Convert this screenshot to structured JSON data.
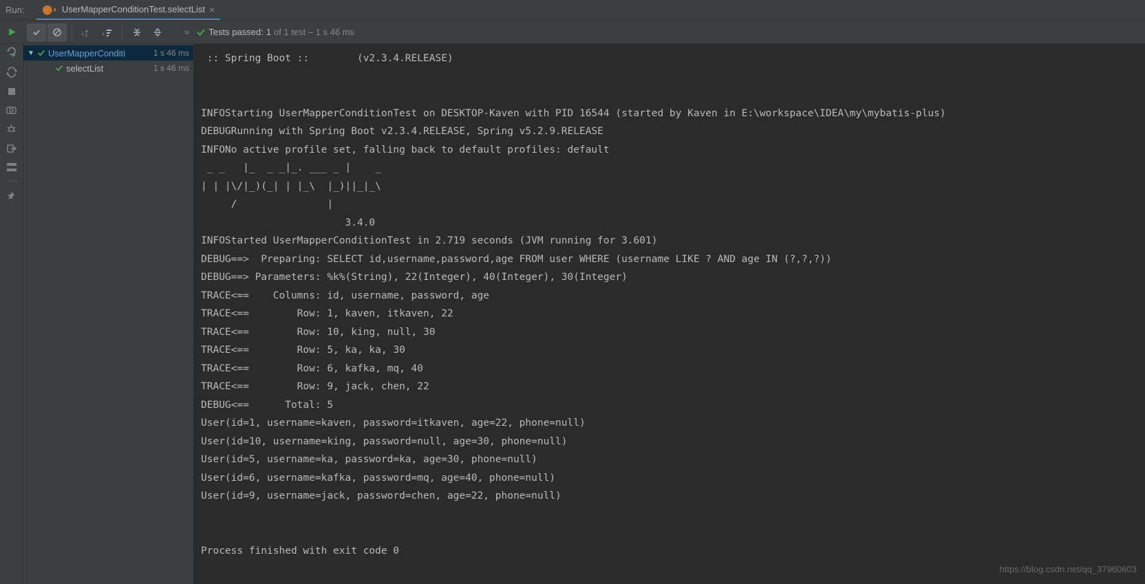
{
  "top": {
    "run_label": "Run:",
    "tab_title": "UserMapperConditionTest.selectList"
  },
  "status": {
    "prefix": "»",
    "tests_passed_label": "Tests passed:",
    "passed_count": "1",
    "of_label": "of 1 test – 1 s 46 ms"
  },
  "tree": {
    "root_name": "UserMapperConditi",
    "root_duration": "1 s 46 ms",
    "child_name": "selectList",
    "child_duration": "1 s 46 ms"
  },
  "console_lines": [
    " :: Spring Boot ::        (v2.3.4.RELEASE)",
    "",
    "",
    "INFOStarting UserMapperConditionTest on DESKTOP-Kaven with PID 16544 (started by Kaven in E:\\workspace\\IDEA\\my\\mybatis-plus)",
    "DEBUGRunning with Spring Boot v2.3.4.RELEASE, Spring v5.2.9.RELEASE",
    "INFONo active profile set, falling back to default profiles: default",
    " _ _   |_  _ _|_. ___ _ |    _ ",
    "| | |\\/|_)(_| | |_\\  |_)||_|_\\ ",
    "     /               |         ",
    "                        3.4.0 ",
    "INFOStarted UserMapperConditionTest in 2.719 seconds (JVM running for 3.601)",
    "DEBUG==>  Preparing: SELECT id,username,password,age FROM user WHERE (username LIKE ? AND age IN (?,?,?))",
    "DEBUG==> Parameters: %k%(String), 22(Integer), 40(Integer), 30(Integer)",
    "TRACE<==    Columns: id, username, password, age",
    "TRACE<==        Row: 1, kaven, itkaven, 22",
    "TRACE<==        Row: 10, king, null, 30",
    "TRACE<==        Row: 5, ka, ka, 30",
    "TRACE<==        Row: 6, kafka, mq, 40",
    "TRACE<==        Row: 9, jack, chen, 22",
    "DEBUG<==      Total: 5",
    "User(id=1, username=kaven, password=itkaven, age=22, phone=null)",
    "User(id=10, username=king, password=null, age=30, phone=null)",
    "User(id=5, username=ka, password=ka, age=30, phone=null)",
    "User(id=6, username=kafka, password=mq, age=40, phone=null)",
    "User(id=9, username=jack, password=chen, age=22, phone=null)",
    "",
    "",
    "Process finished with exit code 0"
  ],
  "watermark": "https://blog.csdn.net/qq_37960603"
}
